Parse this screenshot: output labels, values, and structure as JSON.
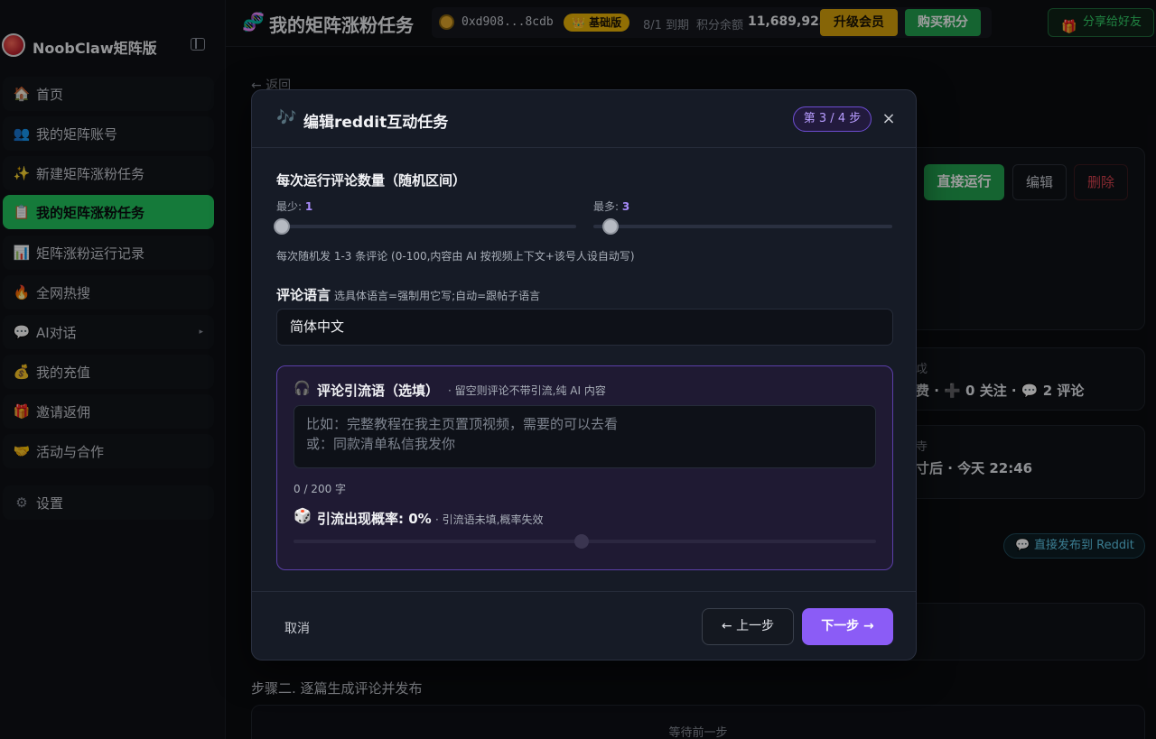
{
  "brand": {
    "name": "NoobClaw矩阵版"
  },
  "sidebar": {
    "items": [
      {
        "icon": "🏠",
        "label": "首页"
      },
      {
        "icon": "👥",
        "label": "我的矩阵账号"
      },
      {
        "icon": "✨",
        "label": "新建矩阵涨粉任务"
      },
      {
        "icon": "📋",
        "label": "我的矩阵涨粉任务"
      },
      {
        "icon": "📊",
        "label": "矩阵涨粉运行记录"
      },
      {
        "icon": "🔥",
        "label": "全网热搜"
      },
      {
        "icon": "💬",
        "label": "AI对话"
      },
      {
        "icon": "💰",
        "label": "我的充值"
      },
      {
        "icon": "🎁",
        "label": "邀请返佣"
      },
      {
        "icon": "🤝",
        "label": "活动与合作"
      }
    ],
    "settings": {
      "icon": "⚙",
      "label": "设置"
    }
  },
  "header": {
    "icon": "🧬",
    "title": "我的矩阵涨粉任务",
    "wallet_address": "0xd908...8cdb",
    "plan_badge": "👑 基础版",
    "expire": "8/1 到期",
    "balance_label": "积分余额",
    "balance_value": "11,689,923",
    "upgrade_label": "升级会员",
    "buy_label": "购买积分",
    "share_icon": "🎁",
    "share_label": "分享给好友"
  },
  "background": {
    "back_link": "← 返回",
    "run_label": "直接运行",
    "edit_label": "编辑",
    "delete_label": "删除",
    "stats_text": "费 · ➕ 0 关注 · 💬 2 评论",
    "stats_title_frag": "戉",
    "schedule_title_frag": "寺",
    "schedule_text": "寸后 · 今天 22:46",
    "publish_icon": "💬",
    "publish_label": "直接发布到 Reddit",
    "step2_title": "步骤二. 逐篇生成评论并发布",
    "waiting_text": "等待前一步"
  },
  "modal": {
    "icon": "🎶",
    "title": "编辑reddit互动任务",
    "step_badge": "第 3 / 4 步",
    "close": "×",
    "count_title": "每次运行评论数量（随机区间）",
    "min_label": "最少:",
    "min_value": "1",
    "max_label": "最多:",
    "max_value": "3",
    "min_fraction": 0.01,
    "max_fraction": 0.03,
    "count_hint": "每次随机发 1-3 条评论 (0-100,内容由 AI 按视频上下文+该号人设自动写)",
    "lang_title": "评论语言",
    "lang_sub": "选具体语言=强制用它写;自动=跟帖子语言",
    "lang_value": "简体中文",
    "lead_icon": "🎧",
    "lead_title": "评论引流语（选填）",
    "lead_sub": "· 留空则评论不带引流,纯 AI 内容",
    "lead_placeholder": "比如：完整教程在我主页置顶视频，需要的可以去看\n或：同款清单私信我发你",
    "char_count": "0 / 200 字",
    "prob_icon": "🎲",
    "prob_title": "引流出现概率: 0%",
    "prob_sub": "· 引流语未填,概率失效",
    "cancel_label": "取消",
    "prev_label": "← 上一步",
    "next_label": "下一步 →"
  }
}
